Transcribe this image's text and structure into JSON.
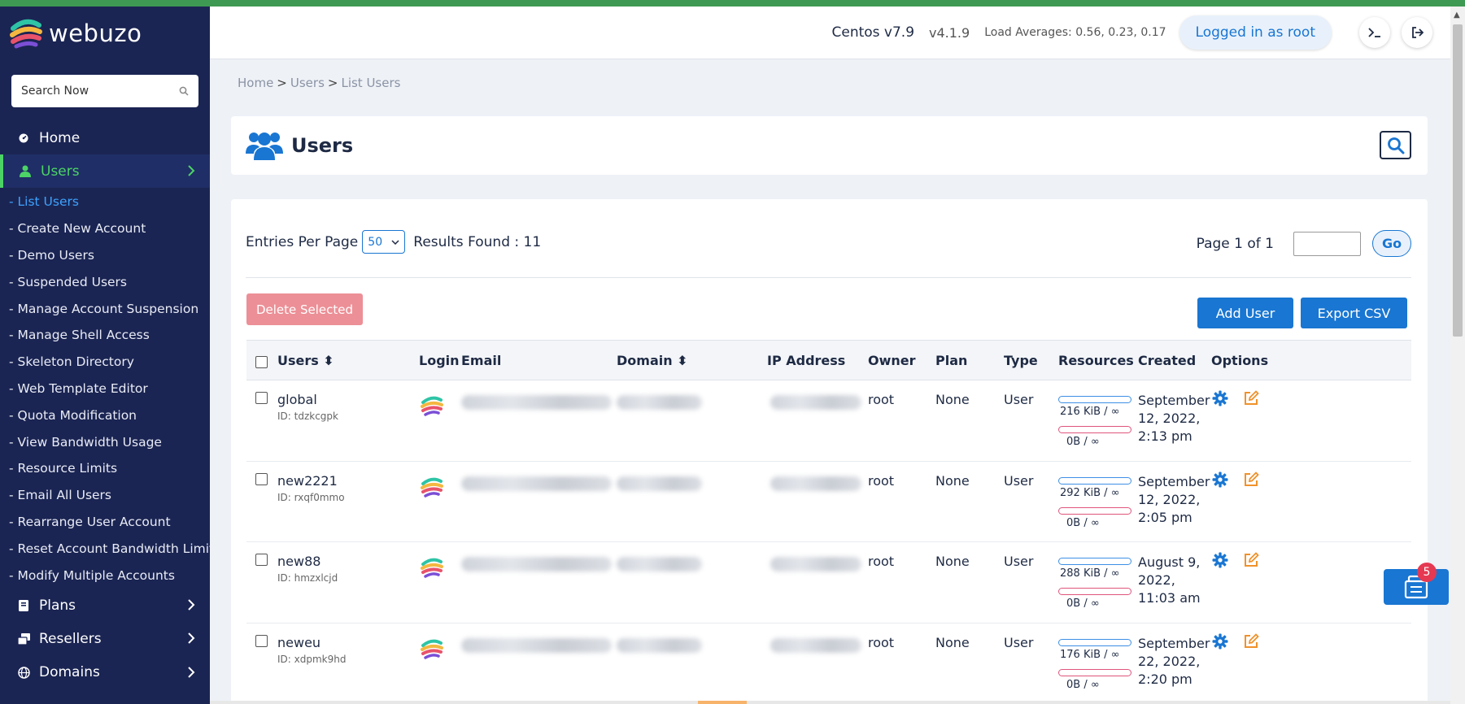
{
  "brand": {
    "name": "webuzo"
  },
  "search": {
    "placeholder": "Search Now"
  },
  "nav": {
    "home": "Home",
    "users": "Users",
    "submenu": [
      "- List Users",
      "- Create New Account",
      "- Demo Users",
      "- Suspended Users",
      "- Manage Account Suspension",
      "- Manage Shell Access",
      "- Skeleton Directory",
      "- Web Template Editor",
      "- Quota Modification",
      "- View Bandwidth Usage",
      "- Resource Limits",
      "- Email All Users",
      "- Rearrange User Account",
      "- Reset Account Bandwidth Limit",
      "- Modify Multiple Accounts"
    ],
    "plans": "Plans",
    "resellers": "Resellers",
    "domains": "Domains"
  },
  "header": {
    "os": "Centos v7.9",
    "version": "v4.1.9",
    "load": "Load Averages: 0.56, 0.23, 0.17",
    "login_status": "Logged in as root"
  },
  "breadcrumb": {
    "home": "Home",
    "users": "Users",
    "list": "List Users"
  },
  "page": {
    "title": "Users"
  },
  "list": {
    "entries_label": "Entries Per Page",
    "entries_value": "50",
    "results": "Results Found : 11",
    "page_label": "Page 1 of 1",
    "go": "Go",
    "delete": "Delete Selected",
    "add": "Add User",
    "export": "Export CSV"
  },
  "table": {
    "columns": {
      "users": "Users",
      "login": "Login",
      "email": "Email",
      "domain": "Domain",
      "ip": "IP Address",
      "owner": "Owner",
      "plan": "Plan",
      "type": "Type",
      "resources": "Resources",
      "created": "Created",
      "options": "Options"
    },
    "rows": [
      {
        "user": "global",
        "id": "ID: tdzkcgpk",
        "owner": "root",
        "plan": "None",
        "type": "User",
        "disk": "216 KiB / ∞",
        "bw": "0B / ∞",
        "created": "September 12, 2022, 2:13 pm"
      },
      {
        "user": "new2221",
        "id": "ID: rxqf0mmo",
        "owner": "root",
        "plan": "None",
        "type": "User",
        "disk": "292 KiB / ∞",
        "bw": "0B / ∞",
        "created": "September 12, 2022, 2:05 pm"
      },
      {
        "user": "new88",
        "id": "ID: hmzxlcjd",
        "owner": "root",
        "plan": "None",
        "type": "User",
        "disk": "288 KiB / ∞",
        "bw": "0B / ∞",
        "created": "August 9, 2022, 11:03 am"
      },
      {
        "user": "neweu",
        "id": "ID: xdpmk9hd",
        "owner": "root",
        "plan": "None",
        "type": "User",
        "disk": "176 KiB / ∞",
        "bw": "0B / ∞",
        "created": "September 22, 2022, 2:20 pm"
      }
    ]
  },
  "float": {
    "badge": "5"
  },
  "colors": {
    "sidebar": "#1b2553",
    "accent": "#1976d2",
    "active": "#4cd366",
    "danger": "#ec8f96"
  }
}
